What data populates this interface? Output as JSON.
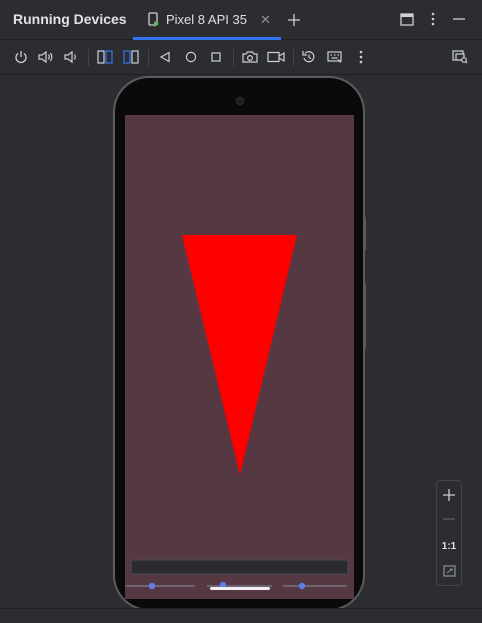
{
  "window": {
    "title": "Running Devices",
    "tabs": [
      {
        "label": "Pixel 8 API 35",
        "icon": "phone-run-icon",
        "active": true
      }
    ],
    "accent_color": "#3574f0"
  },
  "header_actions": {
    "new_tab_icon": "plus-icon",
    "layout_icon": "window-layout-icon",
    "options_icon": "more-vertical-icon",
    "hide_icon": "minimize-icon"
  },
  "toolbar": {
    "items": [
      "power-icon",
      "volume-up-icon",
      "volume-down-icon",
      "rotate-left-icon",
      "rotate-right-icon",
      "back-icon",
      "home-icon",
      "overview-icon",
      "screenshot-icon",
      "screen-record-icon",
      "snapshot-icon",
      "keyboard-icon",
      "more-vertical-icon",
      "device-mirror-settings-icon"
    ]
  },
  "device": {
    "screen_color": "#553842",
    "shape_color": "#ff0000",
    "shape": "triangle-pointing-down"
  },
  "zoom_controls": {
    "zoom_in_icon": "plus-icon",
    "zoom_out_icon": "minus-icon",
    "actual_size_label": "1:1",
    "fit_icon": "fit-screen-icon"
  }
}
